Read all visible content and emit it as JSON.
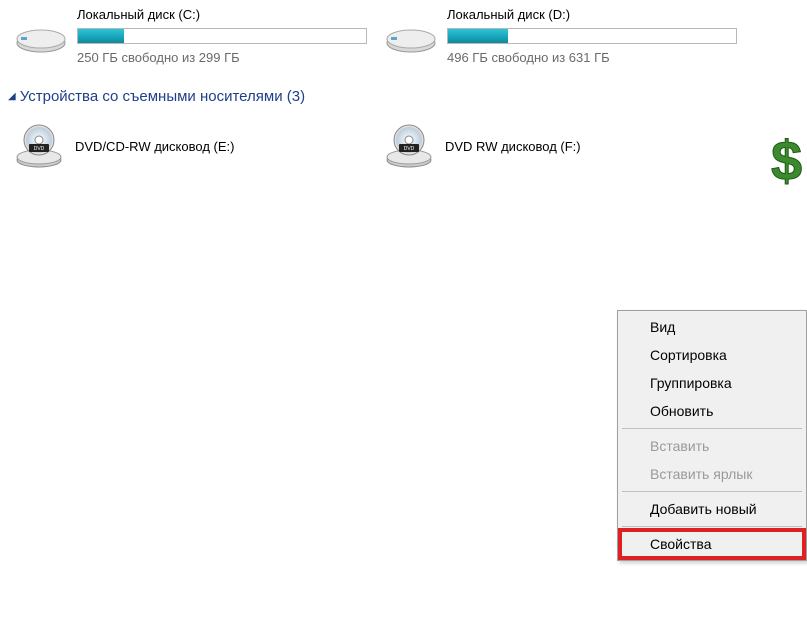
{
  "drives": [
    {
      "name": "Локальный диск (C:)",
      "status": "250 ГБ свободно из 299 ГБ",
      "fill_percent": 16
    },
    {
      "name": "Локальный диск (D:)",
      "status": "496 ГБ свободно из 631 ГБ",
      "fill_percent": 21
    }
  ],
  "section_removable": "Устройства со съемными носителями (3)",
  "removable": [
    {
      "name": "DVD/CD-RW дисковод (E:)"
    },
    {
      "name": "DVD RW дисковод (F:)"
    }
  ],
  "context_menu": {
    "view": "Вид",
    "sort": "Сортировка",
    "group": "Группировка",
    "refresh": "Обновить",
    "paste": "Вставить",
    "paste_shortcut": "Вставить ярлык",
    "add_new": "Добавить новый",
    "properties": "Свойства"
  }
}
